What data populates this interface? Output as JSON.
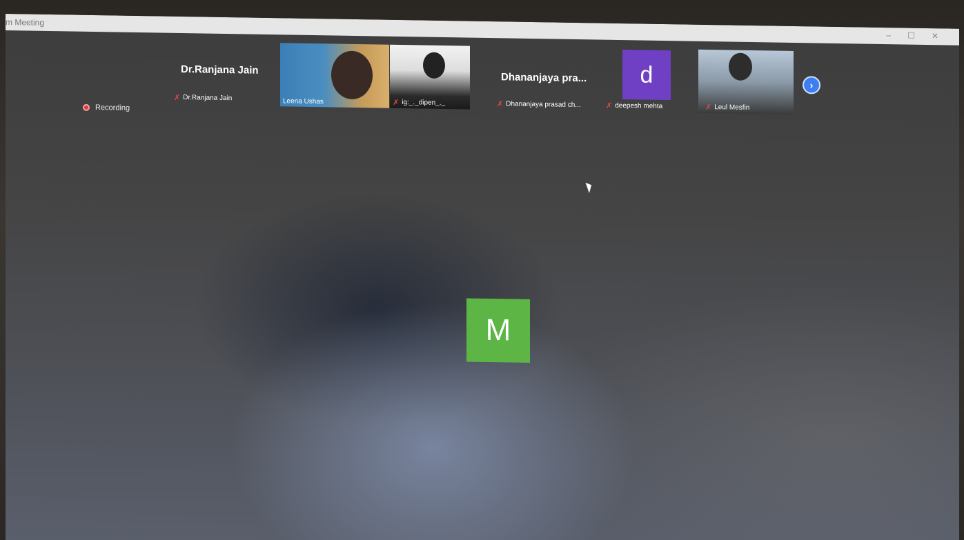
{
  "window": {
    "title": "m Meeting",
    "controls": [
      "–",
      "☐",
      "✕"
    ]
  },
  "status": {
    "recording_label": "Recording"
  },
  "participants": [
    {
      "display_name": "Dr.Ranjana Jain",
      "label": "Dr.Ranjana Jain",
      "muted": true,
      "video": false
    },
    {
      "label": "Leena Ushas",
      "muted": false,
      "video": true
    },
    {
      "label": "ig:_._dipen_._",
      "muted": true,
      "video": true
    },
    {
      "display_name": "Dhananjaya  pra...",
      "label": "Dhananjaya prasad ch...",
      "muted": true,
      "video": false
    },
    {
      "avatar_letter": "d",
      "avatar_color": "#6f3fc4",
      "label": "deepesh mehta",
      "muted": true,
      "video": false
    },
    {
      "label": "Leul Mesfin",
      "muted": true,
      "video": true
    }
  ],
  "active_speaker": {
    "avatar_letter": "M",
    "avatar_color": "#5db546"
  },
  "icons": {
    "mute": "microphone-muted-icon",
    "next": "chevron-right-icon",
    "recording": "record-dot-icon"
  }
}
